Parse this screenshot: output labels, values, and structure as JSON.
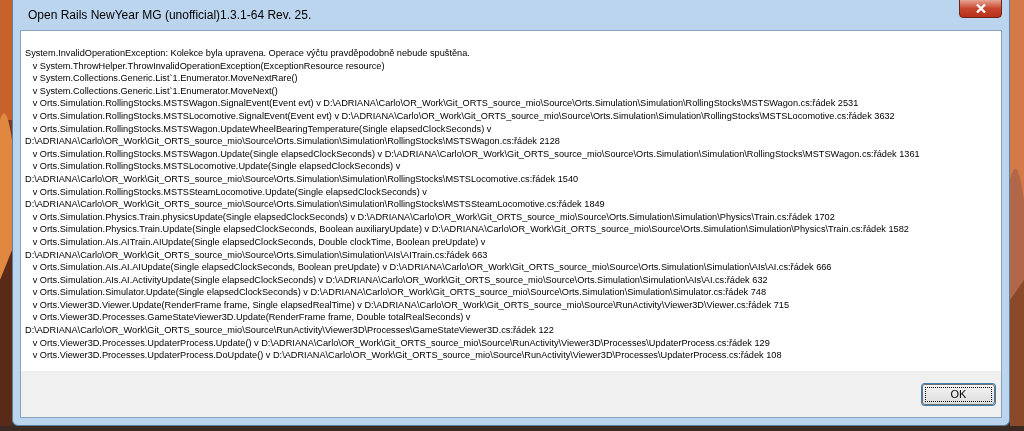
{
  "window": {
    "title": "Open Rails NewYear MG (unofficial)1.3.1-64 Rev. 25."
  },
  "message": "System.InvalidOperationException: Kolekce byla upravena. Operace výčtu pravděpodobně nebude spuštěna.\n   v System.ThrowHelper.ThrowInvalidOperationException(ExceptionResource resource)\n   v System.Collections.Generic.List`1.Enumerator.MoveNextRare()\n   v System.Collections.Generic.List`1.Enumerator.MoveNext()\n   v Orts.Simulation.RollingStocks.MSTSWagon.SignalEvent(Event evt) v D:\\ADRIANA\\Carlo\\OR_Work\\Git_ORTS_source_mio\\Source\\Orts.Simulation\\Simulation\\RollingStocks\\MSTSWagon.cs:řádek 2531\n   v Orts.Simulation.RollingStocks.MSTSLocomotive.SignalEvent(Event evt) v D:\\ADRIANA\\Carlo\\OR_Work\\Git_ORTS_source_mio\\Source\\Orts.Simulation\\Simulation\\RollingStocks\\MSTSLocomotive.cs:řádek 3632\n   v Orts.Simulation.RollingStocks.MSTSWagon.UpdateWheelBearingTemperature(Single elapsedClockSeconds) v\nD:\\ADRIANA\\Carlo\\OR_Work\\Git_ORTS_source_mio\\Source\\Orts.Simulation\\Simulation\\RollingStocks\\MSTSWagon.cs:řádek 2128\n   v Orts.Simulation.RollingStocks.MSTSWagon.Update(Single elapsedClockSeconds) v D:\\ADRIANA\\Carlo\\OR_Work\\Git_ORTS_source_mio\\Source\\Orts.Simulation\\Simulation\\RollingStocks\\MSTSWagon.cs:řádek 1361\n   v Orts.Simulation.RollingStocks.MSTSLocomotive.Update(Single elapsedClockSeconds) v\nD:\\ADRIANA\\Carlo\\OR_Work\\Git_ORTS_source_mio\\Source\\Orts.Simulation\\Simulation\\RollingStocks\\MSTSLocomotive.cs:řádek 1540\n   v Orts.Simulation.RollingStocks.MSTSSteamLocomotive.Update(Single elapsedClockSeconds) v\nD:\\ADRIANA\\Carlo\\OR_Work\\Git_ORTS_source_mio\\Source\\Orts.Simulation\\Simulation\\RollingStocks\\MSTSSteamLocomotive.cs:řádek 1849\n   v Orts.Simulation.Physics.Train.physicsUpdate(Single elapsedClockSeconds) v D:\\ADRIANA\\Carlo\\OR_Work\\Git_ORTS_source_mio\\Source\\Orts.Simulation\\Simulation\\Physics\\Train.cs:řádek 1702\n   v Orts.Simulation.Physics.Train.Update(Single elapsedClockSeconds, Boolean auxiliaryUpdate) v D:\\ADRIANA\\Carlo\\OR_Work\\Git_ORTS_source_mio\\Source\\Orts.Simulation\\Simulation\\Physics\\Train.cs:řádek 1582\n   v Orts.Simulation.AIs.AITrain.AIUpdate(Single elapsedClockSeconds, Double clockTime, Boolean preUpdate) v\nD:\\ADRIANA\\Carlo\\OR_Work\\Git_ORTS_source_mio\\Source\\Orts.Simulation\\Simulation\\AIs\\AITrain.cs:řádek 663\n   v Orts.Simulation.AIs.AI.AIUpdate(Single elapsedClockSeconds, Boolean preUpdate) v D:\\ADRIANA\\Carlo\\OR_Work\\Git_ORTS_source_mio\\Source\\Orts.Simulation\\Simulation\\AIs\\AI.cs:řádek 666\n   v Orts.Simulation.AIs.AI.ActivityUpdate(Single elapsedClockSeconds) v D:\\ADRIANA\\Carlo\\OR_Work\\Git_ORTS_source_mio\\Source\\Orts.Simulation\\Simulation\\AIs\\AI.cs:řádek 632\n   v Orts.Simulation.Simulator.Update(Single elapsedClockSeconds) v D:\\ADRIANA\\Carlo\\OR_Work\\Git_ORTS_source_mio\\Source\\Orts.Simulation\\Simulation\\Simulator.cs:řádek 748\n   v Orts.Viewer3D.Viewer.Update(RenderFrame frame, Single elapsedRealTime) v D:\\ADRIANA\\Carlo\\OR_Work\\Git_ORTS_source_mio\\Source\\RunActivity\\Viewer3D\\Viewer.cs:řádek 715\n   v Orts.Viewer3D.Processes.GameStateViewer3D.Update(RenderFrame frame, Double totalRealSeconds) v\nD:\\ADRIANA\\Carlo\\OR_Work\\Git_ORTS_source_mio\\Source\\RunActivity\\Viewer3D\\Processes\\GameStateViewer3D.cs:řádek 122\n   v Orts.Viewer3D.Processes.UpdaterProcess.Update() v D:\\ADRIANA\\Carlo\\OR_Work\\Git_ORTS_source_mio\\Source\\RunActivity\\Viewer3D\\Processes\\UpdaterProcess.cs:řádek 129\n   v Orts.Viewer3D.Processes.UpdaterProcess.DoUpdate() v D:\\ADRIANA\\Carlo\\OR_Work\\Git_ORTS_source_mio\\Source\\RunActivity\\Viewer3D\\Processes\\UpdaterProcess.cs:řádek 108",
  "buttons": [
    {
      "label": "OK",
      "focused": true
    }
  ]
}
